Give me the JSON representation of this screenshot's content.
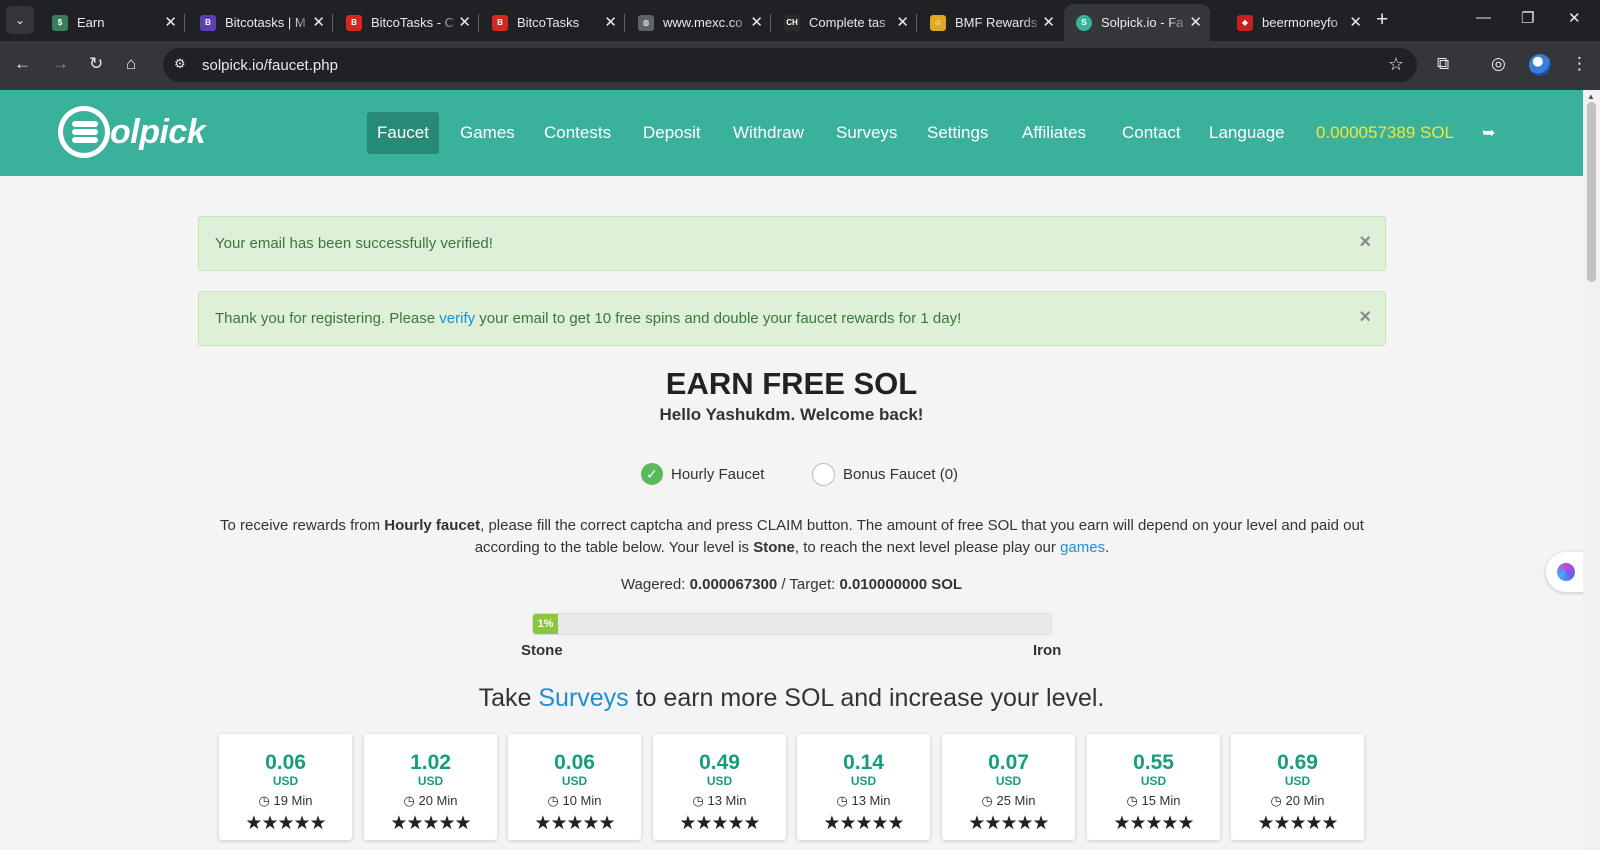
{
  "browser": {
    "tabs": [
      {
        "title": "Earn",
        "fav_color": "#3a7d5c",
        "fav_glyph": "$"
      },
      {
        "title": "Bitcotasks | M",
        "fav_color": "#5b3fb5",
        "fav_glyph": "B"
      },
      {
        "title": "BitcoTasks - C",
        "fav_color": "#d7261e",
        "fav_glyph": "B"
      },
      {
        "title": "BitcoTasks",
        "fav_color": "#d7261e",
        "fav_glyph": "B"
      },
      {
        "title": "www.mexc.co",
        "fav_color": "#5f6368",
        "fav_glyph": "◍"
      },
      {
        "title": "Complete tas",
        "fav_color": "#2b2b2b",
        "fav_glyph": "CH"
      },
      {
        "title": "BMF Rewards",
        "fav_color": "#e0a820",
        "fav_glyph": "☺"
      },
      {
        "title": "Solpick.io - Fa",
        "fav_color": "#3ab19b",
        "fav_glyph": "S"
      },
      {
        "title": "beermoneyfo",
        "fav_color": "#c8201c",
        "fav_glyph": "◆"
      }
    ],
    "url": "solpick.io/faucet.php"
  },
  "header": {
    "logo_text": "olpick",
    "nav": [
      "Faucet",
      "Games",
      "Contests",
      "Deposit",
      "Withdraw",
      "Surveys",
      "Settings",
      "Affiliates",
      "Contact",
      "Language"
    ],
    "balance": "0.000057389 SOL"
  },
  "alerts": {
    "verified": "Your email has been successfully verified!",
    "register_before": "Thank you for registering. Please ",
    "register_link": "verify",
    "register_after": " your email to get 10 free spins and double your faucet rewards for 1 day!"
  },
  "main": {
    "title": "EARN FREE SOL",
    "welcome": "Hello Yashukdm. Welcome back!",
    "faucet_options": [
      "Hourly Faucet",
      "Bonus Faucet (0)"
    ],
    "desc_1": "To receive rewards from ",
    "desc_bold_1": "Hourly faucet",
    "desc_2": ", please fill the correct captcha and press CLAIM button. The amount of free SOL that you earn will depend on your level and paid out according to the table below. Your level is ",
    "desc_bold_2": "Stone",
    "desc_3": ", to reach the next level please play our ",
    "desc_link": "games",
    "desc_4": ".",
    "wagered_label": "Wagered: ",
    "wagered_value": "0.000067300",
    "target_label": " / Target: ",
    "target_value": "0.010000000 SOL",
    "progress_label": "1%",
    "progress_fraction": 0.01,
    "level_current": "Stone",
    "level_next": "Iron",
    "surveys_before": "Take ",
    "surveys_link": "Surveys",
    "surveys_after": " to earn more SOL and increase your level."
  },
  "offers": [
    {
      "amount": "0.06",
      "currency": "USD",
      "time": "19 Min",
      "stars": "★★★★★"
    },
    {
      "amount": "1.02",
      "currency": "USD",
      "time": "20 Min",
      "stars": "★★★★★"
    },
    {
      "amount": "0.06",
      "currency": "USD",
      "time": "10 Min",
      "stars": "★★★★★"
    },
    {
      "amount": "0.49",
      "currency": "USD",
      "time": "13 Min",
      "stars": "★★★★★"
    },
    {
      "amount": "0.14",
      "currency": "USD",
      "time": "13 Min",
      "stars": "★★★★★"
    },
    {
      "amount": "0.07",
      "currency": "USD",
      "time": "25 Min",
      "stars": "★★★★★"
    },
    {
      "amount": "0.55",
      "currency": "USD",
      "time": "15 Min",
      "stars": "★★★★★"
    },
    {
      "amount": "0.69",
      "currency": "USD",
      "time": "20 Min",
      "stars": "★★★★★"
    }
  ],
  "colors": {
    "brand": "#3ab19b",
    "balance": "#f5e53a",
    "alert_bg": "#dff0d8",
    "offer_amount": "#159e7d",
    "link": "#1e8fd6"
  }
}
